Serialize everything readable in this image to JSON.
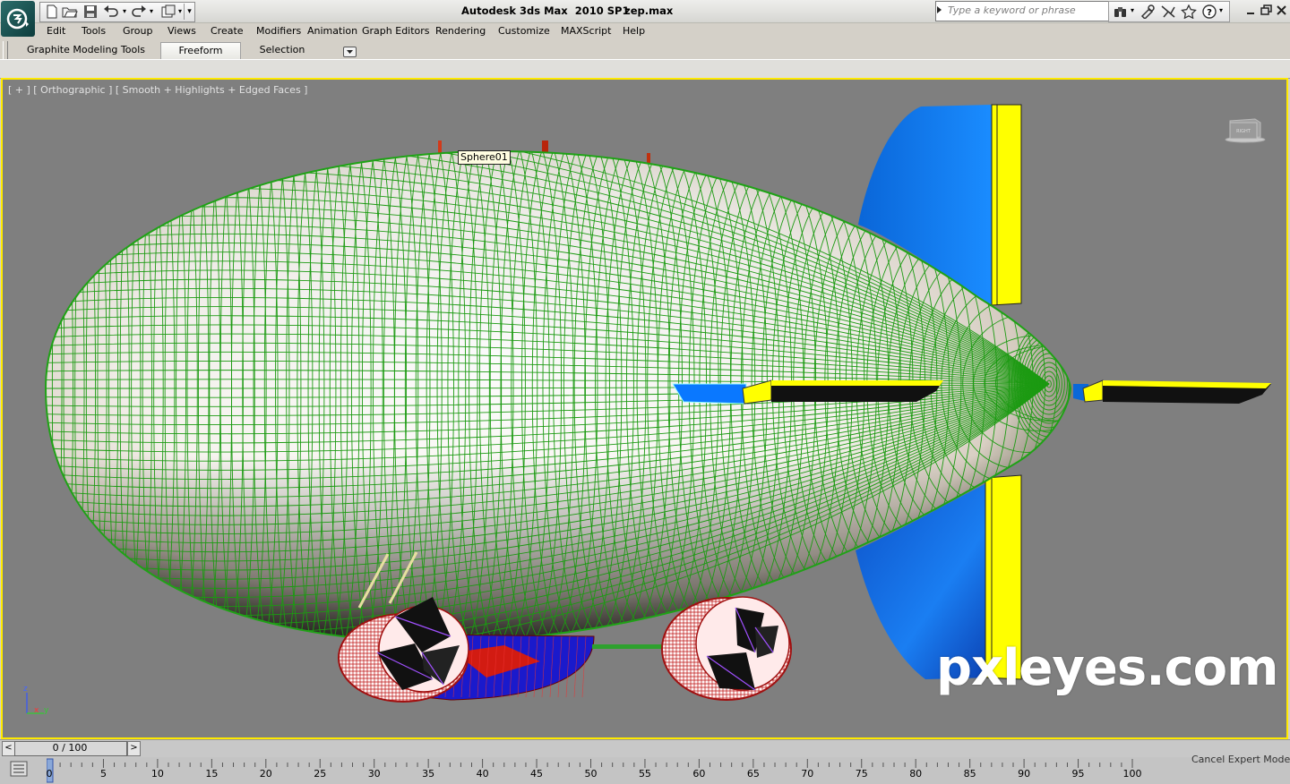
{
  "titlebar": {
    "app_title": "Autodesk 3ds Max  2010 SP1",
    "file_name": "zep.max",
    "search_placeholder": "Type a keyword or phrase"
  },
  "menu": [
    "Edit",
    "Tools",
    "Group",
    "Views",
    "Create",
    "Modifiers",
    "Animation",
    "Graph Editors",
    "Rendering",
    "Customize",
    "MAXScript",
    "Help"
  ],
  "ribbon": {
    "tabs": [
      "Graphite Modeling Tools",
      "Freeform",
      "Selection"
    ],
    "active_tab": "Freeform"
  },
  "viewport": {
    "label": "[ + ] [ Orthographic ] [ Smooth + Highlights + Edged Faces ]",
    "tooltip": "Sphere01",
    "viewcube_face": "RIGHT",
    "axis": {
      "z": "z",
      "x": "x",
      "y": "y"
    },
    "border_color": "#ffea00",
    "background_color": "#7f7f7f"
  },
  "timeline": {
    "frame_readout": "0 / 100",
    "prev_label": "<",
    "next_label": ">",
    "ruler_labels": [
      "0",
      "5",
      "10",
      "15",
      "20",
      "25",
      "30",
      "35",
      "40",
      "45",
      "50",
      "55",
      "60",
      "65",
      "70",
      "75",
      "80",
      "85",
      "90",
      "95",
      "100"
    ]
  },
  "status": {
    "cancel_expert_mode": "Cancel Expert Mode"
  },
  "watermark": "pxleyes.com",
  "colors": {
    "wire": "#119911",
    "fin_blue": "#1280f0",
    "fin_yellow": "#ffff00",
    "engine_wire": "#aa1111"
  }
}
